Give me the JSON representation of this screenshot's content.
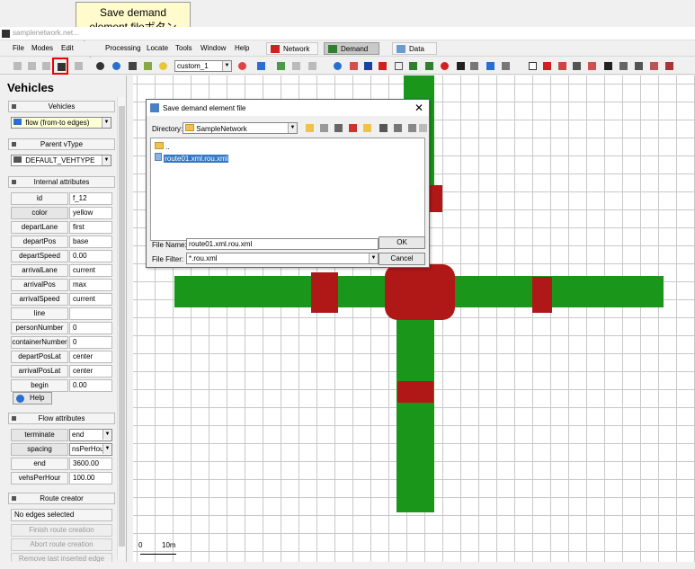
{
  "callout": {
    "line1": "Save demand",
    "line2": "element fileボタン"
  },
  "window": {
    "title": "samplenetwork.net..."
  },
  "menubar": {
    "items": [
      "File",
      "Modes",
      "Edit",
      "Processing",
      "Locate",
      "Tools",
      "Window",
      "Help"
    ],
    "supermodes": [
      "Network",
      "Demand",
      "Data"
    ]
  },
  "toolbar": {
    "view_combo": "custom_1"
  },
  "panel": {
    "title": "Vehicles",
    "sections": {
      "vehicles": "Vehicles",
      "parent_vtype": "Parent vType",
      "internal": "Internal attributes",
      "flow": "Flow attributes",
      "route_creator": "Route creator"
    },
    "vehicle_type_select": "flow (from-to edges)",
    "vtype_select": "DEFAULT_VEHTYPE",
    "internal_attrs": [
      {
        "label": "id",
        "value": "f_12"
      },
      {
        "label": "color",
        "value": "yellow"
      },
      {
        "label": "departLane",
        "value": "first"
      },
      {
        "label": "departPos",
        "value": "base"
      },
      {
        "label": "departSpeed",
        "value": "0.00"
      },
      {
        "label": "arrivalLane",
        "value": "current"
      },
      {
        "label": "arrivalPos",
        "value": "max"
      },
      {
        "label": "arrivalSpeed",
        "value": "current"
      },
      {
        "label": "line",
        "value": ""
      },
      {
        "label": "personNumber",
        "value": "0"
      },
      {
        "label": "containerNumber",
        "value": "0"
      },
      {
        "label": "departPosLat",
        "value": "center"
      },
      {
        "label": "arrivalPosLat",
        "value": "center"
      },
      {
        "label": "begin",
        "value": "0.00"
      }
    ],
    "help": "Help",
    "flow_attrs": [
      {
        "label": "terminate",
        "value": "end"
      },
      {
        "label": "spacing",
        "value": "nsPerHour"
      },
      {
        "label": "end",
        "value": "3600.00"
      },
      {
        "label": "vehsPerHour",
        "value": "100.00"
      }
    ],
    "route_status": "No edges selected",
    "finish_route": "Finish route creation",
    "abort_route": "Abort route creation",
    "remove_last": "Remove last inserted edge"
  },
  "scale": {
    "zero": "0",
    "ten": "10m"
  },
  "dialog": {
    "title": "Save demand element file",
    "directory_label": "Directory:",
    "directory": "SampleNetwork",
    "entries": [
      "..",
      "route01.xml.rou.xml"
    ],
    "filename_label": "File Name:",
    "filename": "route01.xml.rou.xml",
    "filter_label": "File Filter:",
    "filter": "*.rou.xml",
    "ok": "OK",
    "cancel": "Cancel"
  },
  "colors": {
    "road": "#1a961a",
    "junction": "#b01818",
    "callout": "#fffbcc",
    "highlight": "#e00000"
  }
}
